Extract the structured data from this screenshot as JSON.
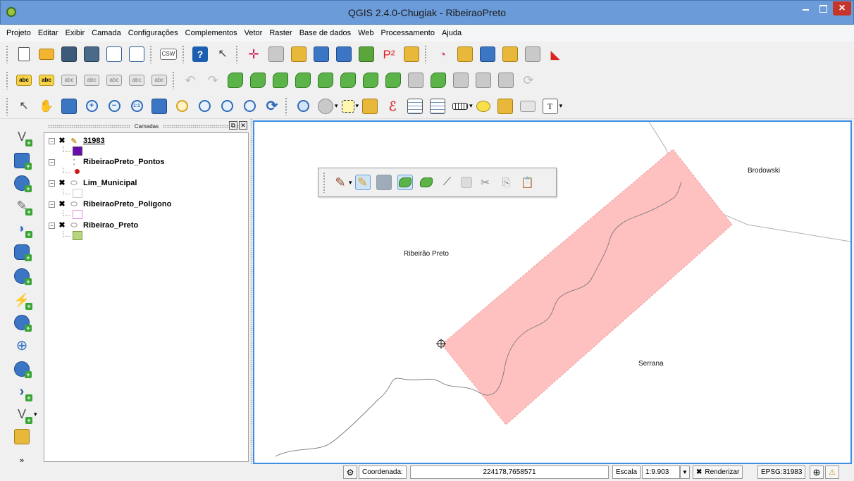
{
  "window": {
    "title": "QGIS 2.4.0-Chugiak - RibeiraoPreto"
  },
  "menu": [
    "Projeto",
    "Editar",
    "Exibir",
    "Camada",
    "Configurações",
    "Complementos",
    "Vetor",
    "Raster",
    "Base de dados",
    "Web",
    "Processamento",
    "Ajuda"
  ],
  "toolbar1": {
    "csw_label": "CSW",
    "p2_label": "P²"
  },
  "toolbar2": {
    "label_icon_text": "abc"
  },
  "layers_panel": {
    "title": "Camadas",
    "layers": [
      {
        "name": "31983",
        "checked": true,
        "swatch_color": "#6a0dad"
      },
      {
        "name": "RibeiraoPreto_Pontos",
        "checked": false,
        "point_color": "#d01818"
      },
      {
        "name": "Lim_Municipal",
        "checked": true,
        "swatch_color": "#ffffff"
      },
      {
        "name": "RibeiraoPreto_Poligono",
        "checked": true,
        "swatch_color": "#ffffff"
      },
      {
        "name": "Ribeirao_Preto",
        "checked": true,
        "swatch_color": "#b5d67a"
      }
    ],
    "check_mark": "✖"
  },
  "map": {
    "labels": [
      "Brodowski",
      "Ribeirão Preto",
      "Serrana"
    ],
    "polygon_fill": "#ffc0c0",
    "polygon_stroke": "#e8a0a0"
  },
  "statusbar": {
    "coord_label": "Coordenada:",
    "coord_value": "224178,7658571",
    "scale_label": "Escala",
    "scale_value": "1:9.903",
    "render_label": "Renderizar",
    "crs": "EPSG:31983"
  },
  "colors": {
    "titlebar": "#6b9bd8",
    "map_border": "#3d8ee6"
  }
}
